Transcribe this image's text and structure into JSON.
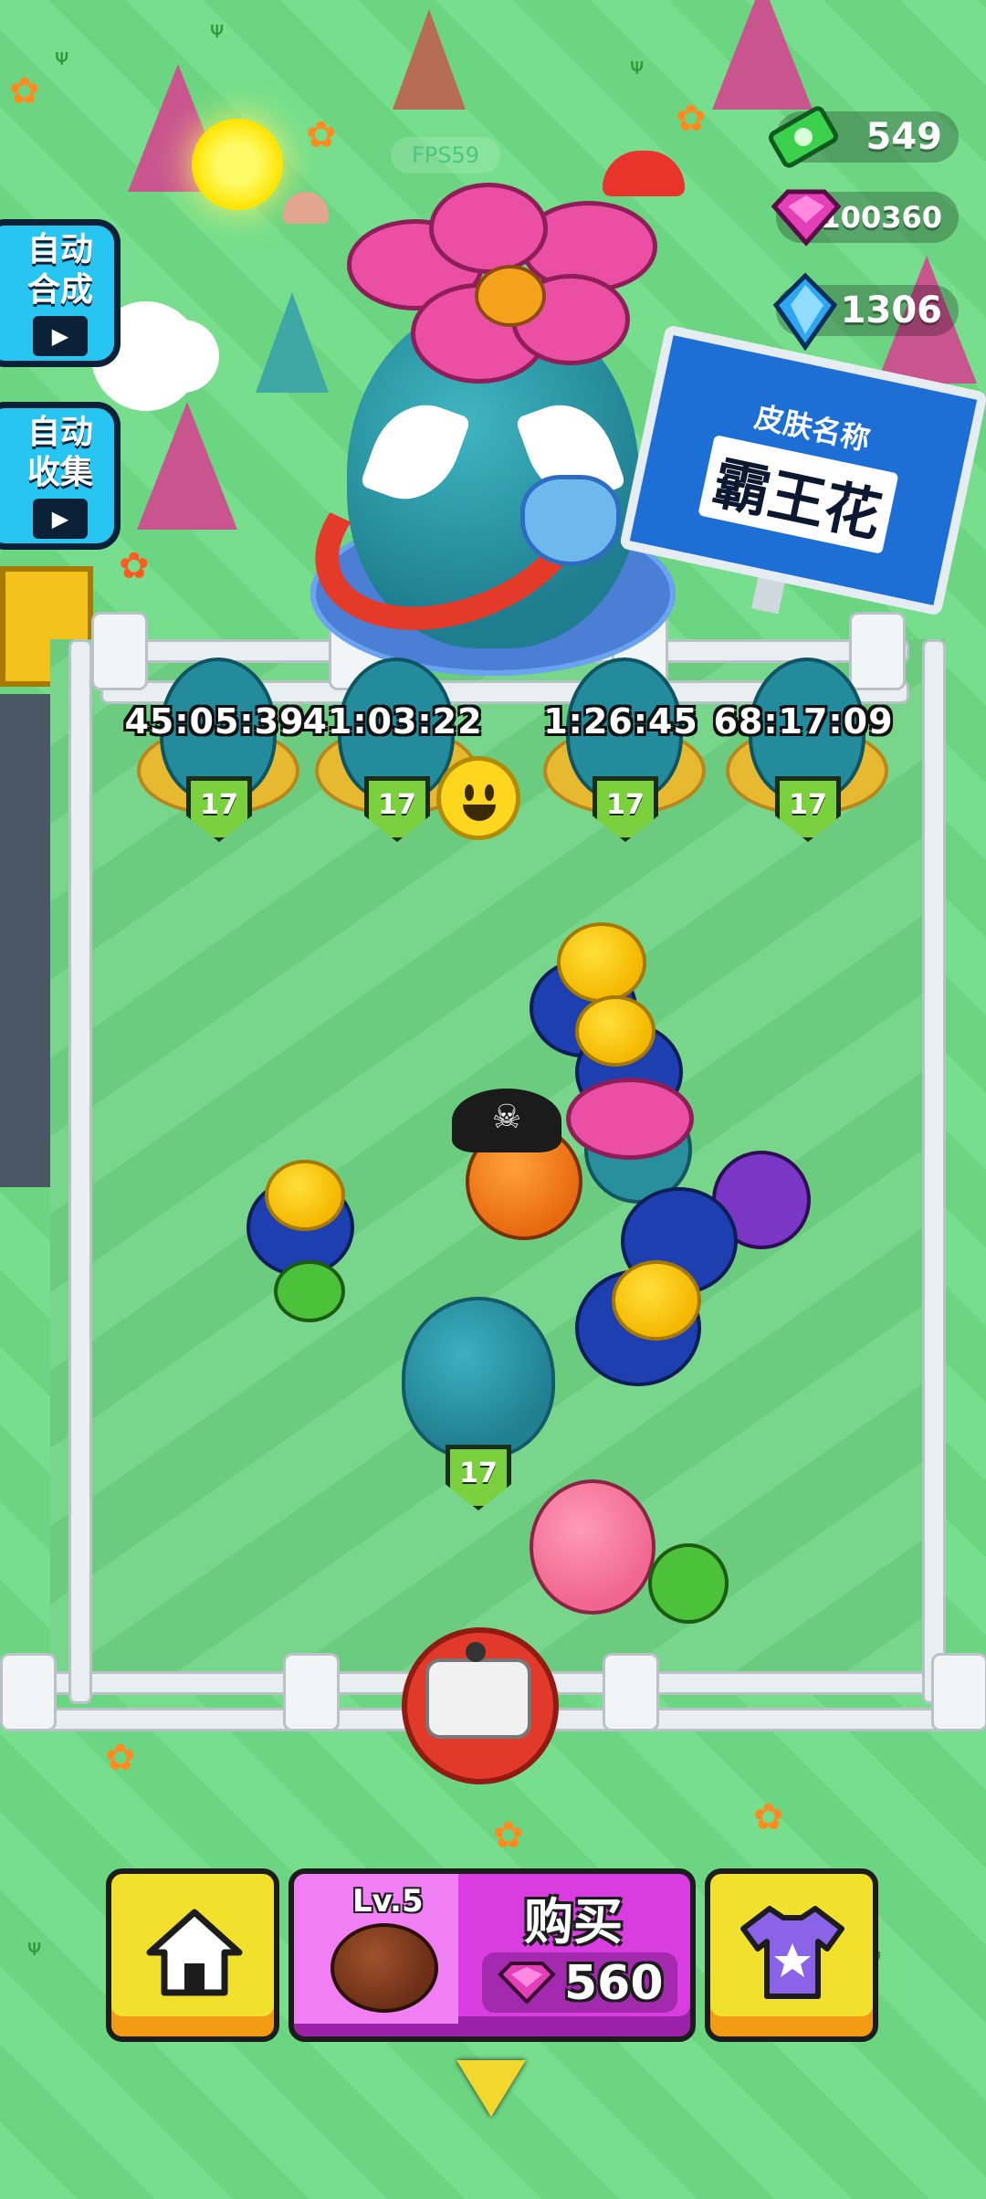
{
  "hud": {
    "fps_text": "FPS59",
    "currency": [
      {
        "icon": "cash-icon",
        "value": "549",
        "color": "#3bd14c"
      },
      {
        "icon": "pink-gem-icon",
        "value": "100360",
        "color": "#e33fb7"
      },
      {
        "icon": "blue-crystal-icon",
        "value": "1306",
        "color": "#2fa6f0"
      }
    ]
  },
  "side_buttons": [
    {
      "line1": "自动",
      "line2": "合成",
      "icon": "video-ad-icon"
    },
    {
      "line1": "自动",
      "line2": "收集",
      "icon": "video-ad-icon"
    }
  ],
  "sign": {
    "subtitle": "皮肤名称",
    "title": "霸王花"
  },
  "nests": [
    {
      "timer": "45:05:39",
      "level": "17"
    },
    {
      "timer": "41:03:22",
      "level": "17"
    },
    {
      "timer": "1:26:45",
      "level": "17"
    },
    {
      "timer": "68:17:09",
      "level": "17"
    }
  ],
  "field_egg": {
    "level": "17"
  },
  "bottom_bar": {
    "home_icon": "home-icon",
    "buy": {
      "level_label": "Lv.5",
      "label": "购买",
      "price": "560",
      "price_icon": "pink-gem-icon"
    },
    "shop_icon": "shirt-icon"
  },
  "colors": {
    "grass": "#6fdc86",
    "accent_yellow": "#f2e12c",
    "accent_purple": "#d93de0",
    "side_button_blue": "#27c5f2"
  }
}
